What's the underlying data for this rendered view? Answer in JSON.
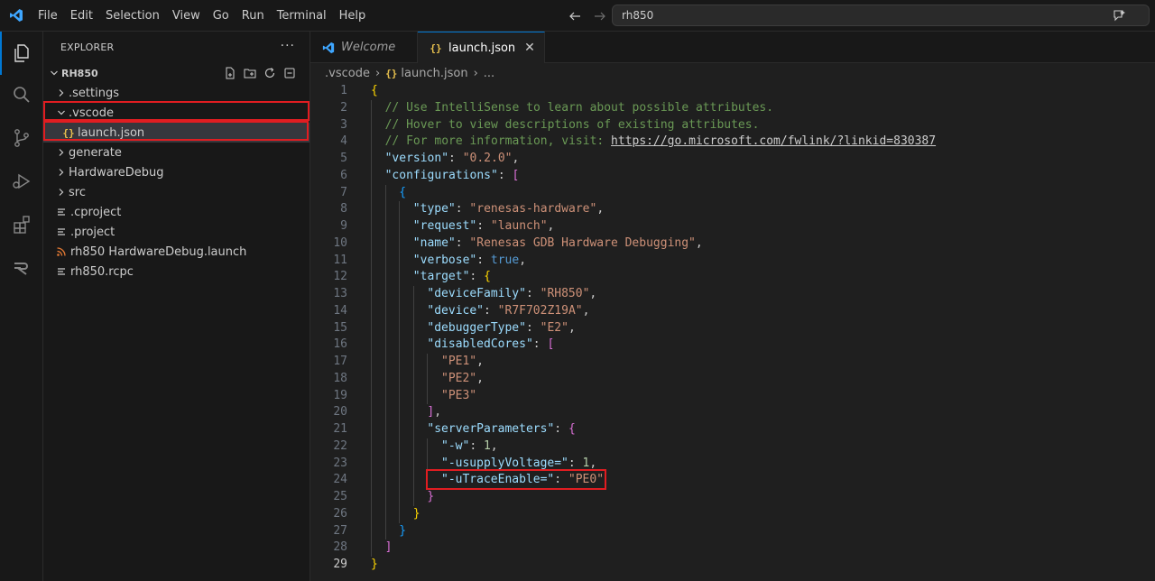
{
  "titlebar": {
    "menu": [
      "File",
      "Edit",
      "Selection",
      "View",
      "Go",
      "Run",
      "Terminal",
      "Help"
    ],
    "search_text": "rh850"
  },
  "activitybar": {
    "items": [
      "explorer-icon",
      "search-icon",
      "source-control-icon",
      "run-debug-icon",
      "extensions-icon",
      "renesas-icon"
    ]
  },
  "sidebar": {
    "title": "EXPLORER",
    "more": "···",
    "root": "RH850",
    "items": [
      {
        "label": ".settings",
        "type": "folder",
        "expanded": false,
        "depth": 1
      },
      {
        "label": ".vscode",
        "type": "folder",
        "expanded": true,
        "depth": 1
      },
      {
        "label": "launch.json",
        "type": "json",
        "depth": 2
      },
      {
        "label": "generate",
        "type": "folder",
        "expanded": false,
        "depth": 1
      },
      {
        "label": "HardwareDebug",
        "type": "folder",
        "expanded": false,
        "depth": 1
      },
      {
        "label": "src",
        "type": "folder",
        "expanded": false,
        "depth": 1
      },
      {
        "label": ".cproject",
        "type": "file",
        "depth": 1
      },
      {
        "label": ".project",
        "type": "file",
        "depth": 1
      },
      {
        "label": "rh850 HardwareDebug.launch",
        "type": "rss",
        "depth": 1
      },
      {
        "label": "rh850.rcpc",
        "type": "file",
        "depth": 1
      }
    ]
  },
  "editor": {
    "tabs": [
      {
        "label": "Welcome",
        "active": false
      },
      {
        "label": "launch.json",
        "active": true
      }
    ],
    "breadcrumb": [
      ".vscode",
      "launch.json",
      "..."
    ],
    "braces_glyph": "{}",
    "lines": [
      "{",
      "// Use IntelliSense to learn about possible attributes.",
      "// Hover to view descriptions of existing attributes.",
      "// For more information, visit: https://go.microsoft.com/fwlink/?linkid=830387",
      "\"version\": \"0.2.0\",",
      "\"configurations\": [",
      "{",
      "\"type\": \"renesas-hardware\",",
      "\"request\": \"launch\",",
      "\"name\": \"Renesas GDB Hardware Debugging\",",
      "\"verbose\": true,",
      "\"target\": {",
      "\"deviceFamily\": \"RH850\",",
      "\"device\": \"R7F702Z19A\",",
      "\"debuggerType\": \"E2\",",
      "\"disabledCores\": [",
      "\"PE1\",",
      "\"PE2\",",
      "\"PE3\"",
      "],",
      "\"serverParameters\": {",
      "\"-w\": 1,",
      "\"-usupplyVoltage=\": 1,",
      "\"-uTraceEnable=\": \"PE0\"",
      "}",
      "}",
      "}",
      "]",
      "}"
    ],
    "active_line": 29
  }
}
